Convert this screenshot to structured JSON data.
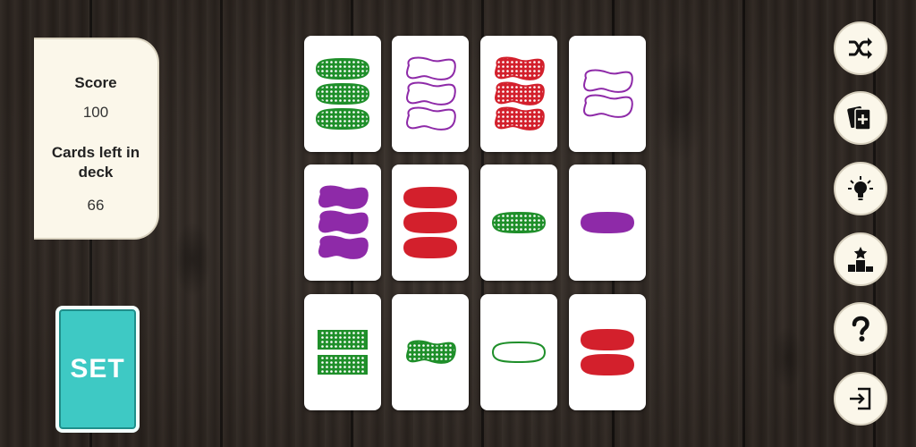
{
  "score": {
    "label": "Score",
    "value": "100"
  },
  "deck": {
    "label": "Cards left in deck",
    "value": "66"
  },
  "set_button": {
    "label": "SET"
  },
  "colors": {
    "green": "#1f8f2a",
    "purple": "#8e2aa8",
    "red": "#d3202c",
    "teal": "#3ec9c4"
  },
  "cards": [
    {
      "count": 3,
      "shape": "oval",
      "color": "green",
      "fill": "dotted"
    },
    {
      "count": 3,
      "shape": "squiggle",
      "color": "purple",
      "fill": "empty"
    },
    {
      "count": 3,
      "shape": "squiggle",
      "color": "red",
      "fill": "dotted"
    },
    {
      "count": 2,
      "shape": "squiggle",
      "color": "purple",
      "fill": "empty"
    },
    {
      "count": 3,
      "shape": "squiggle",
      "color": "purple",
      "fill": "solid"
    },
    {
      "count": 3,
      "shape": "oval",
      "color": "red",
      "fill": "solid"
    },
    {
      "count": 1,
      "shape": "oval",
      "color": "green",
      "fill": "dotted"
    },
    {
      "count": 1,
      "shape": "oval",
      "color": "purple",
      "fill": "solid"
    },
    {
      "count": 2,
      "shape": "rectangle",
      "color": "green",
      "fill": "dotted"
    },
    {
      "count": 1,
      "shape": "squiggle",
      "color": "green",
      "fill": "dotted"
    },
    {
      "count": 1,
      "shape": "oval",
      "color": "green",
      "fill": "empty"
    },
    {
      "count": 2,
      "shape": "oval",
      "color": "red",
      "fill": "solid"
    }
  ],
  "sidebar_buttons": [
    {
      "name": "shuffle-icon"
    },
    {
      "name": "add-cards-icon"
    },
    {
      "name": "hint-lightbulb-icon"
    },
    {
      "name": "leaderboard-icon"
    },
    {
      "name": "help-icon"
    },
    {
      "name": "exit-icon"
    }
  ]
}
